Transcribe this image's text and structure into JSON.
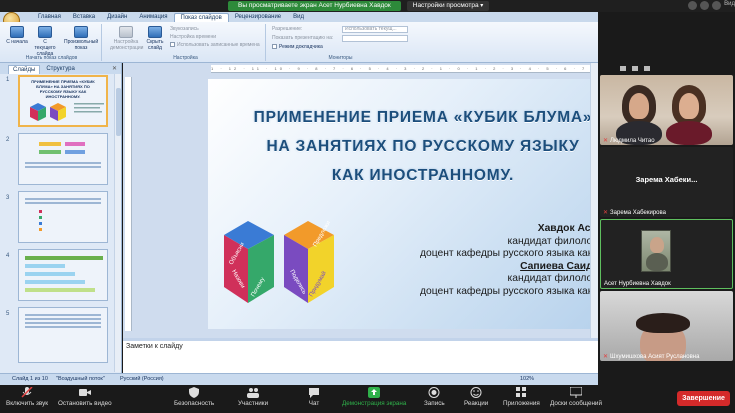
{
  "zoom": {
    "share_message": "Вы просматриваете экран Асет Нурбиевна Хавдок",
    "view_options": "Настройки просмотра",
    "video_label": "Вид",
    "toolbar": [
      {
        "label": "Включить звук",
        "icon": "microphone-muted-icon"
      },
      {
        "label": "Остановить видео",
        "icon": "video-camera-icon"
      },
      {
        "label": "Безопасность",
        "icon": "shield-icon"
      },
      {
        "label": "Участники",
        "icon": "participants-icon",
        "count": "4"
      },
      {
        "label": "Чат",
        "icon": "chat-icon"
      },
      {
        "label": "Демонстрация экрана",
        "icon": "share-screen-icon"
      },
      {
        "label": "Запись",
        "icon": "record-icon"
      },
      {
        "label": "Реакции",
        "icon": "reactions-icon"
      },
      {
        "label": "Приложения",
        "icon": "apps-icon"
      },
      {
        "label": "Доски сообщений",
        "icon": "whiteboard-icon"
      }
    ],
    "end_label": "Завершение"
  },
  "ppt": {
    "tabs": [
      "Главная",
      "Вставка",
      "Дизайн",
      "Анимация",
      "Показ слайдов",
      "Рецензирование",
      "Вид"
    ],
    "active_tab": "Показ слайдов",
    "ribbon": {
      "start_group": "Начать показ слайдов",
      "btn_from_start": "С начала",
      "btn_from_current": "С текущего слайда",
      "btn_custom": "Произвольный показ",
      "setup_group": "Настройка",
      "btn_setup": "Настройка демонстрации",
      "btn_hide": "Скрыть слайд",
      "opt_record": "Звукозапись",
      "opt_rehearse": "Настройка времени",
      "opt_use_timings": "Использовать записанные времена",
      "monitors_group": "Мониторы",
      "resolution_label": "Разрешение:",
      "resolution_value": "Использовать текущ...",
      "show_on_label": "Показать презентацию на:",
      "presenter_view": "Режим докладчика"
    },
    "panel_tabs": [
      "Слайды",
      "Структура"
    ],
    "slide_title": [
      "ПРИМЕНЕНИЕ ПРИЕМА «КУБИК  БЛУМА»",
      "НА ЗАНЯТИЯХ ПО РУССКОМУ ЯЗЫКУ",
      "КАК ИНОСТРАННОМУ."
    ],
    "authors": [
      {
        "text": "Хавдок Асет Нурбиевна",
        "style": "name"
      },
      {
        "text": "кандидат филологических наук,",
        "style": "normal"
      },
      {
        "text": "доцент кафедры русского языка как иностранного",
        "style": "normal"
      },
      {
        "text": "Сапиева Саида Казбековна",
        "style": "name-underline"
      },
      {
        "text": "кандидат филологических наук,",
        "style": "normal"
      },
      {
        "text": "доцент кафедры русского языка как иностранного",
        "style": "normal"
      }
    ],
    "cube_left_faces": [
      "Объясни",
      "Назови",
      "Почему"
    ],
    "cube_right_faces": [
      "Предложи",
      "Поделись",
      "Придумай"
    ],
    "thumb_title": "ПРИМЕНЕНИЕ ПРИЕМА «КУБИК БЛУМА» НА ЗАНЯТИЯХ ПО РУССКОМУ ЯЗЫКУ КАК ИНОСТРАННОМУ.",
    "thumb_numbers": [
      "1",
      "2",
      "3",
      "4",
      "5"
    ],
    "notes": "Заметки к слайду",
    "status_slide": "Слайд 1 из 10",
    "status_theme": "\"Воздушный поток\"",
    "status_lang": "Русский (Россия)",
    "zoom_level": "102%"
  },
  "participants": [
    {
      "name": "Людмила Читао",
      "muted": true
    },
    {
      "name": "Зарема Хабекирова",
      "display": "Зарема  Хабеки...",
      "muted": true
    },
    {
      "name": "Асет Нурбиевна Хавдок",
      "muted": false
    },
    {
      "name": "Шхумишхова Асият Руслановна",
      "muted": true
    }
  ],
  "colors": {
    "title": "#1c4e7c",
    "zoom_green": "#2fb14a",
    "end_red": "#d42a2a",
    "cube_red": "#d0305a",
    "cube_green": "#35a86a",
    "cube_blue": "#3a7bd5",
    "cube_orange": "#f29a2a",
    "cube_yellow": "#f2d32a",
    "cube_purple": "#7a4bc0"
  }
}
